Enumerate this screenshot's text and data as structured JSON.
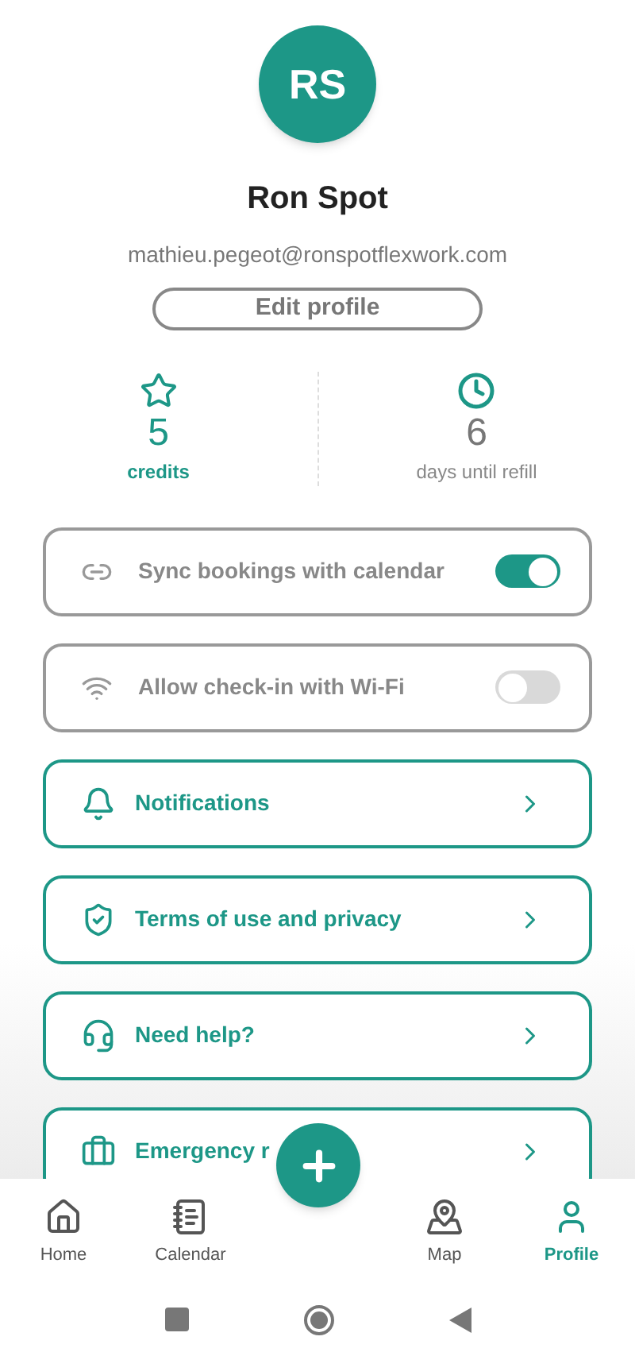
{
  "profile": {
    "initials": "RS",
    "name": "Ron Spot",
    "email": "mathieu.pegeot@ronspotflexwork.com",
    "edit_button": "Edit profile"
  },
  "stats": [
    {
      "kind": "credits",
      "value": "5",
      "label": "credits"
    },
    {
      "kind": "refill",
      "value": "6",
      "label": "days until refill"
    }
  ],
  "settings": [
    {
      "kind": "toggle",
      "label": "Sync bookings with calendar",
      "on": true
    },
    {
      "kind": "toggle",
      "label": "Allow check-in with Wi-Fi",
      "on": false
    },
    {
      "kind": "link",
      "label": "Notifications"
    },
    {
      "kind": "link",
      "label": "Terms of use and privacy"
    },
    {
      "kind": "link",
      "label": "Need help?"
    },
    {
      "kind": "link",
      "label": "Emergency r"
    }
  ],
  "bottom_nav": [
    {
      "label": "Home",
      "selected": false
    },
    {
      "label": "Calendar",
      "selected": false
    },
    {
      "label": "Map",
      "selected": false
    },
    {
      "label": "Profile",
      "selected": true
    }
  ]
}
